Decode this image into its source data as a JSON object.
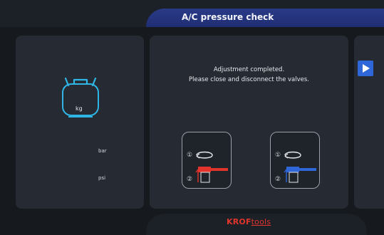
{
  "header": {
    "title": "A/C pressure check"
  },
  "left_panel": {
    "scale_unit": "kg",
    "pressure_unit_1": "bar",
    "pressure_unit_2": "psi",
    "icon": "refrigerant-bottle-icon"
  },
  "main": {
    "message_line_1": "Adjustment completed.",
    "message_line_2": "Please close and disconnect the valves.",
    "valves": [
      {
        "name": "low-side-valve",
        "color": "#e0342c",
        "step_1": "①",
        "step_2": "②"
      },
      {
        "name": "high-side-valve",
        "color": "#2f67d8",
        "step_1": "①",
        "step_2": "②"
      }
    ]
  },
  "right_panel": {
    "icon": "play-icon"
  },
  "footer": {
    "brand_part_1": "KROF",
    "brand_part_2": "tools"
  },
  "colors": {
    "accent_blue": "#2f67d8",
    "title_bar": "#2a3a86",
    "brand_red": "#e0342c",
    "bottle_cyan": "#2fb6e6"
  }
}
